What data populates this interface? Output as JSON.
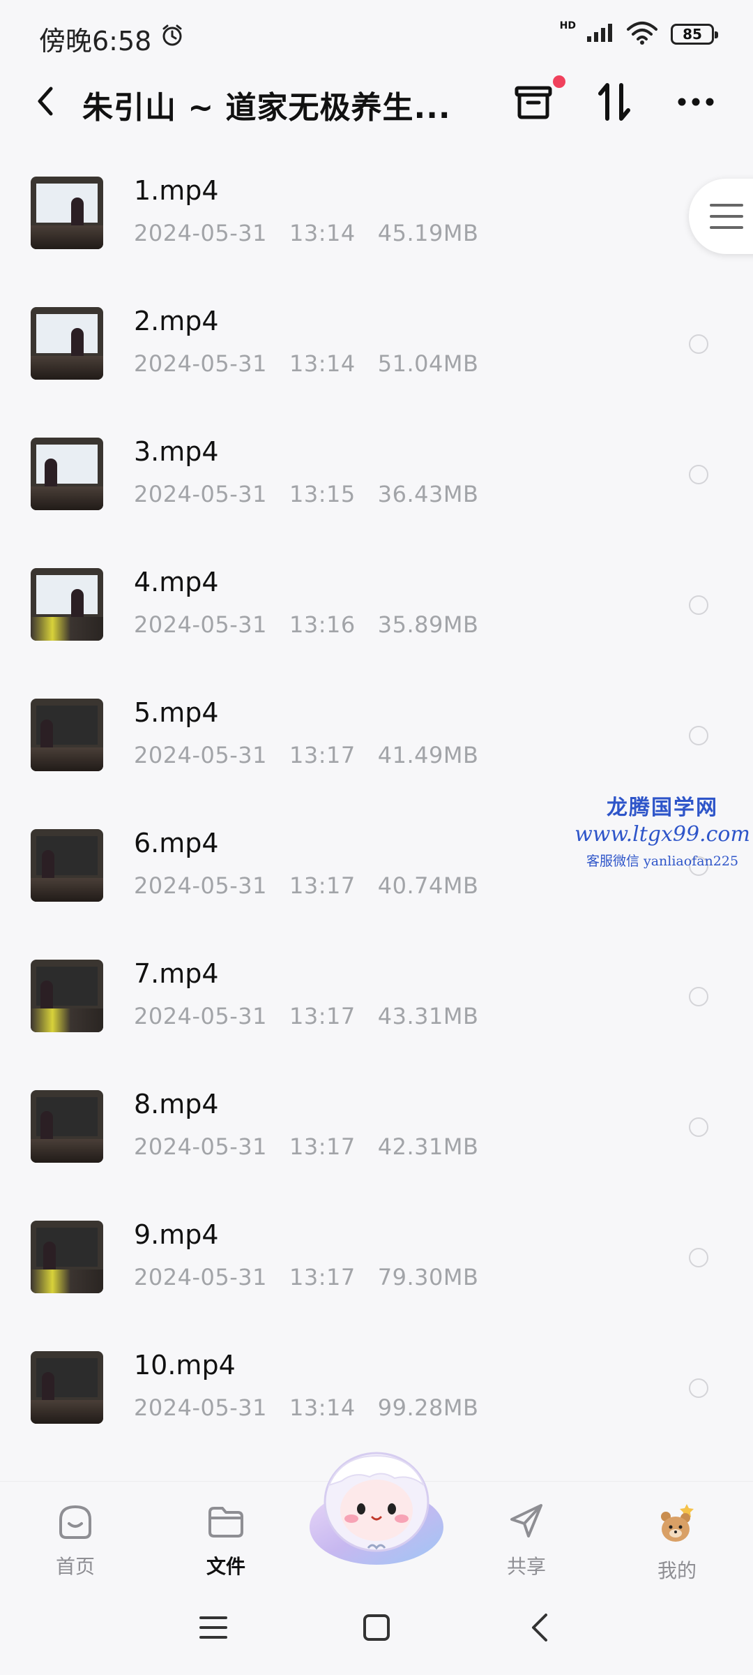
{
  "status_bar": {
    "time": "傍晚6:58",
    "network": "HD",
    "battery": "85"
  },
  "header": {
    "title": "朱引山 ~ 道家无极养生..."
  },
  "files": [
    {
      "name": "1.mp4",
      "meta": "2024-05-31   13:14   45.19MB"
    },
    {
      "name": "2.mp4",
      "meta": "2024-05-31   13:14   51.04MB"
    },
    {
      "name": "3.mp4",
      "meta": "2024-05-31   13:15   36.43MB"
    },
    {
      "name": "4.mp4",
      "meta": "2024-05-31   13:16   35.89MB"
    },
    {
      "name": "5.mp4",
      "meta": "2024-05-31   13:17   41.49MB"
    },
    {
      "name": "6.mp4",
      "meta": "2024-05-31   13:17   40.74MB"
    },
    {
      "name": "7.mp4",
      "meta": "2024-05-31   13:17   43.31MB"
    },
    {
      "name": "8.mp4",
      "meta": "2024-05-31   13:17   42.31MB"
    },
    {
      "name": "9.mp4",
      "meta": "2024-05-31   13:17   79.30MB"
    },
    {
      "name": "10.mp4",
      "meta": "2024-05-31   13:14   99.28MB"
    }
  ],
  "watermark": {
    "line1": "龙腾国学网",
    "line2": "www.ltgx99.com",
    "line3": "客服微信 yanliaofan225"
  },
  "bottom_nav": {
    "home": "首页",
    "files": "文件",
    "share": "共享",
    "mine": "我的"
  },
  "colors": {
    "accent_dot": "#f0415c",
    "meta_text": "#a2a4a8",
    "watermark": "#2e55c9"
  }
}
